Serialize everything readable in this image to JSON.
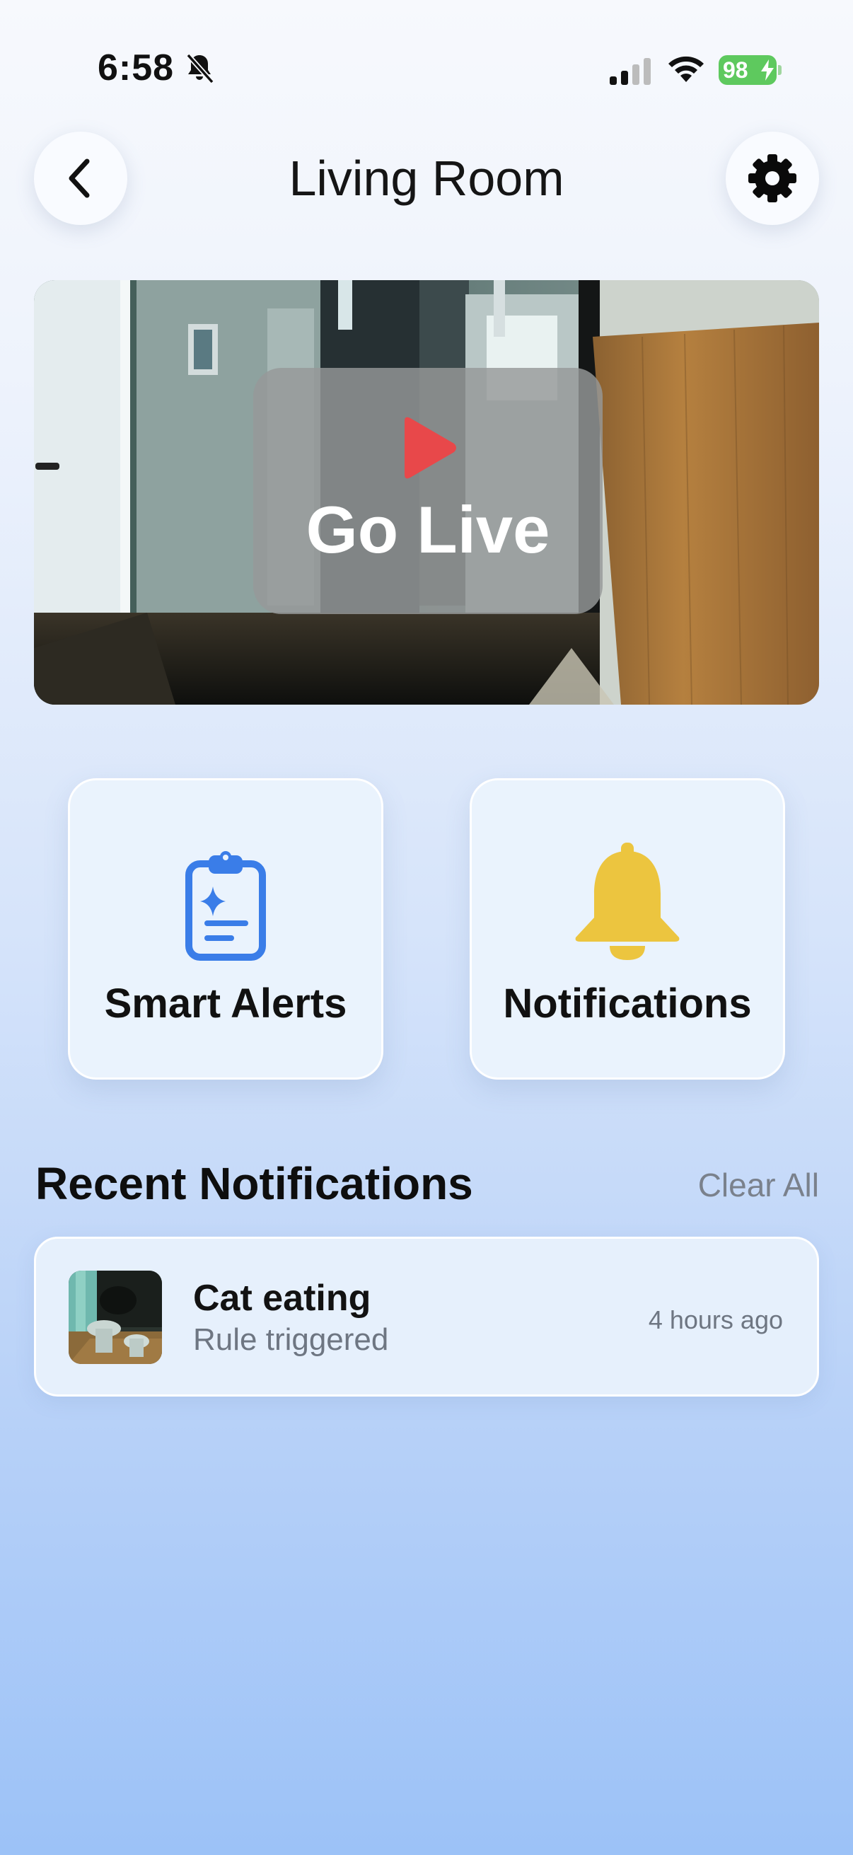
{
  "status_bar": {
    "time": "6:58",
    "battery": "98",
    "battery_color": "#5ec95e"
  },
  "header": {
    "title": "Living Room",
    "back_icon": "chevron-left-icon",
    "settings_icon": "gear-icon"
  },
  "camera": {
    "go_live_label": "Go Live",
    "play_color": "#e8484a"
  },
  "tiles": [
    {
      "label": "Smart Alerts",
      "icon": "clipboard-sparkle-icon",
      "icon_color": "#3a7de8"
    },
    {
      "label": "Notifications",
      "icon": "bell-icon",
      "icon_color": "#ecc53f"
    }
  ],
  "recent": {
    "title": "Recent Notifications",
    "clear_all": "Clear All",
    "items": [
      {
        "title": "Cat eating",
        "subtitle": "Rule triggered",
        "time": "4 hours ago"
      }
    ]
  }
}
